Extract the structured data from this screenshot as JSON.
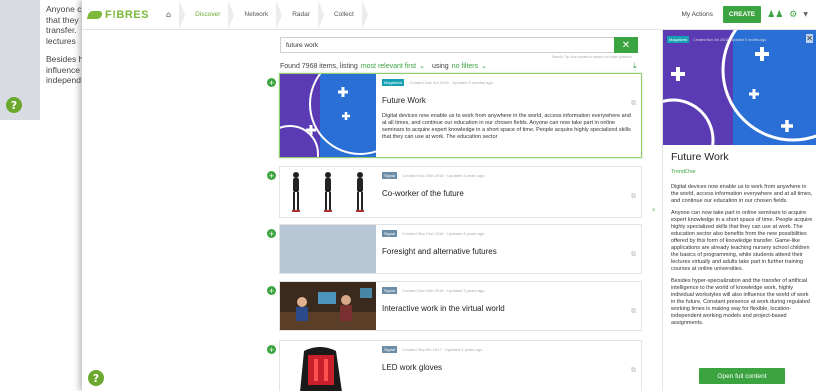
{
  "background": {
    "lines": [
      "Anyone c",
      "that they",
      "transfer.",
      "lectures"
    ],
    "lines2": [
      "Besides h",
      "influence",
      "independ"
    ]
  },
  "nav": {
    "logo": "F!BRES",
    "crumbs": [
      "Discover",
      "Network",
      "Radar",
      "Collect"
    ],
    "my_actions": "My Actions",
    "create": "CREATE"
  },
  "search": {
    "value": "future work",
    "tip": "Search Tip: Use quotes to search for exact phrases"
  },
  "results": {
    "found": "Found 7968 items, listing",
    "sort": "most relevant first",
    "using": "using",
    "filter": "no filters"
  },
  "cards": [
    {
      "tag": "Magalized",
      "meta": "Created Nov 3rd 2016 · Updated 5 months ago",
      "title": "Future Work",
      "desc": "Digital devices now enable us to work from anywhere in the world, access information everywhere and at all times, and continue our education in our chosen fields. Anyone can now take part in online seminars to acquire expert knowledge in a short space of time. People acquire highly specialized skills that they can use at work. The education sector"
    },
    {
      "tag": "Signal",
      "meta": "Created Nov 29th 2016 · Updated 3 years ago",
      "title": "Co-worker of the future",
      "desc": ""
    },
    {
      "tag": "Signal",
      "meta": "Created Sep 21st 2016 · Updated 4 years ago",
      "title": "Foresight and alternative futures",
      "desc": ""
    },
    {
      "tag": "Signal",
      "meta": "Created Nov 15th 2016 · Updated 3 years ago",
      "title": "Interactive work in the virtual world",
      "desc": ""
    },
    {
      "tag": "Signal",
      "meta": "Created Sep 9th 2017 · Updated 4 years ago",
      "title": "LED work gloves",
      "desc": ""
    }
  ],
  "detail": {
    "tag": "Magalized",
    "meta": "Created Nov 3rd 2016 · Updated 5 months ago",
    "title": "Future Work",
    "source": "TrendOne",
    "paragraphs": [
      "Digital devices now enable us to work from anywhere in the world, access information everywhere and at all times, and continue our education in our chosen fields.",
      "Anyone can now take part in online seminars to acquire expert knowledge in a short space of time. People acquire highly specialized skills that they can use at work. The education sector also benefits from the new possibilities offered by this form of knowledge transfer. Game-like applications are already teaching nursery school children the basics of programming, while students attend their lectures virtually and adults take part in further training courses at online universities.",
      "Besides hyper-specialization and the transfer of artificial intelligence to the world of knowledge work, highly individual workstyles will also influence the world of work in the future. Constant presence at work during regulated working times is making way for flexible, location-independent working models and project-based assignments."
    ],
    "open_button": "Open full content"
  }
}
